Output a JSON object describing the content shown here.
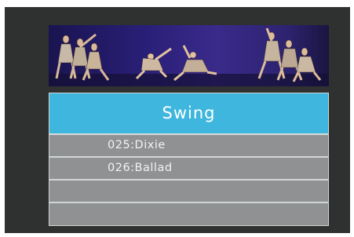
{
  "colors": {
    "screen_bg": "#2f3030",
    "title_bar": "#3fb6dd",
    "row_bg": "#8f9192",
    "divider": "#d3d6d7",
    "text": "#f2f2f2"
  },
  "banner": {
    "image": "dancers-stage-photo"
  },
  "menu": {
    "title": "Swing",
    "rows": [
      {
        "label": "025:Dixie"
      },
      {
        "label": "026:Ballad"
      },
      {
        "label": ""
      },
      {
        "label": ""
      }
    ]
  }
}
